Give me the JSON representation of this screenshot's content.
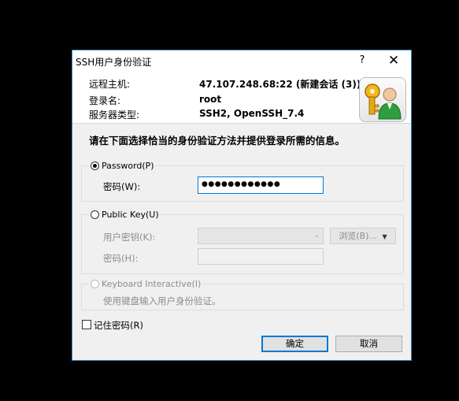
{
  "dialog": {
    "title": "SSH用户身份验证",
    "help_label": "?",
    "close_label": "✕"
  },
  "header": {
    "remote_host_label": "远程主机:",
    "remote_host_value": "47.107.248.68:22 (新建会话 (3))",
    "login_name_label": "登录名:",
    "login_name_value": "root",
    "server_type_label": "服务器类型:",
    "server_type_value": "SSH2, OpenSSH_7.4",
    "icon": "keys-user-icon"
  },
  "instruction": "请在下面选择恰当的身份验证方法并提供登录所需的信息。",
  "password_group": {
    "option_label": "Password(P)",
    "selected": true,
    "field_label": "密码(W):",
    "masked_value": "●●●●●●●●●●●●"
  },
  "publickey_group": {
    "option_label": "Public Key(U)",
    "selected": false,
    "key_label": "用户密钥(K):",
    "key_value": "",
    "browse_label": "浏览(B)...",
    "passphrase_label": "密码(H):",
    "passphrase_value": ""
  },
  "keyboard_group": {
    "option_label": "Keyboard Interactive(I)",
    "selected": false,
    "description": "使用键盘输入用户身份验证。"
  },
  "remember_password": {
    "label": "记住密码(R)",
    "checked": false
  },
  "buttons": {
    "ok_label": "确定",
    "cancel_label": "取消"
  },
  "colors": {
    "accent": "#0078d7",
    "dialog_bg": "#f0f0f0",
    "screen_bg": "#000000"
  }
}
